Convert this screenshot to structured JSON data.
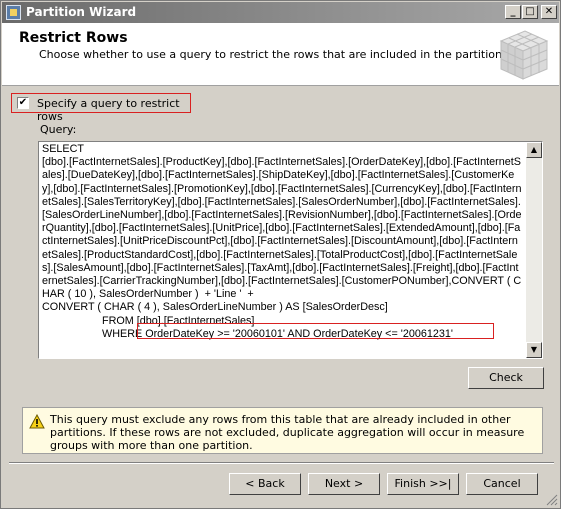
{
  "window": {
    "title": "Partition Wizard"
  },
  "header": {
    "title": "Restrict Rows",
    "description": "Choose whether to use a query to restrict the rows that are included in the partition."
  },
  "checkbox": {
    "label": "Specify a query to restrict rows",
    "checked": true
  },
  "query": {
    "label": "Query:",
    "text": "SELECT\n[dbo].[FactInternetSales].[ProductKey],[dbo].[FactInternetSales].[OrderDateKey],[dbo].[FactInternetSales].[DueDateKey],[dbo].[FactInternetSales].[ShipDateKey],[dbo].[FactInternetSales].[CustomerKey],[dbo].[FactInternetSales].[PromotionKey],[dbo].[FactInternetSales].[CurrencyKey],[dbo].[FactInternetSales].[SalesTerritoryKey],[dbo].[FactInternetSales].[SalesOrderNumber],[dbo].[FactInternetSales].[SalesOrderLineNumber],[dbo].[FactInternetSales].[RevisionNumber],[dbo].[FactInternetSales].[OrderQuantity],[dbo].[FactInternetSales].[UnitPrice],[dbo].[FactInternetSales].[ExtendedAmount],[dbo].[FactInternetSales].[UnitPriceDiscountPct],[dbo].[FactInternetSales].[DiscountAmount],[dbo].[FactInternetSales].[ProductStandardCost],[dbo].[FactInternetSales].[TotalProductCost],[dbo].[FactInternetSales].[SalesAmount],[dbo].[FactInternetSales].[TaxAmt],[dbo].[FactInternetSales].[Freight],[dbo].[FactInternetSales].[CarrierTrackingNumber],[dbo].[FactInternetSales].[CustomerPONumber],CONVERT ( CHAR ( 10 ), SalesOrderNumber )  + 'Line '  +\nCONVERT ( CHAR ( 4 ), SalesOrderLineNumber ) AS [SalesOrderDesc]\n                    FROM [dbo].[FactInternetSales]\n                    WHERE OrderDateKey >= '20060101' AND OrderDateKey <= '20061231'"
  },
  "buttons": {
    "check": "Check",
    "back": "< Back",
    "next": "Next >",
    "finish": "Finish >>|",
    "cancel": "Cancel"
  },
  "warning": {
    "text": "This query must exclude any rows from this table that are already included in other partitions. If these rows are not excluded, duplicate aggregation will occur in measure groups with more than one partition."
  },
  "icons": {
    "title": "partition-wizard-icon",
    "cube": "cube-graphic",
    "warning": "warning-icon"
  }
}
